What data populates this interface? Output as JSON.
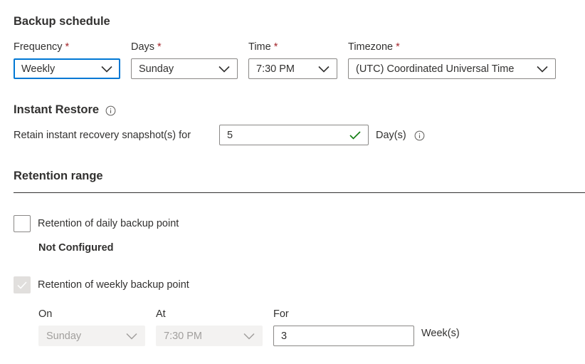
{
  "backup_schedule": {
    "title": "Backup schedule",
    "frequency": {
      "label": "Frequency",
      "required": "*",
      "value": "Weekly"
    },
    "days": {
      "label": "Days",
      "required": "*",
      "value": "Sunday"
    },
    "time": {
      "label": "Time",
      "required": "*",
      "value": "7:30 PM"
    },
    "timezone": {
      "label": "Timezone",
      "required": "*",
      "value": "(UTC) Coordinated Universal Time"
    }
  },
  "instant_restore": {
    "title": "Instant Restore",
    "retain_label": "Retain instant recovery snapshot(s) for",
    "retain_value": "5",
    "unit": "Day(s)"
  },
  "retention_range": {
    "title": "Retention range",
    "daily": {
      "label": "Retention of daily backup point",
      "checked": false,
      "status": "Not Configured"
    },
    "weekly": {
      "label": "Retention of weekly backup point",
      "checked": true,
      "on_label": "On",
      "on_value": "Sunday",
      "at_label": "At",
      "at_value": "7:30 PM",
      "for_label": "For",
      "for_value": "3",
      "unit": "Week(s)"
    }
  },
  "colors": {
    "required": "#a4262c",
    "focus_border": "#0078d4",
    "valid_check": "#107c10",
    "disabled_bg": "#f3f2f1",
    "disabled_text": "#a19f9d"
  },
  "icons": {
    "chevron": "chevron-down-icon",
    "info": "info-icon",
    "valid": "checkmark-icon"
  }
}
